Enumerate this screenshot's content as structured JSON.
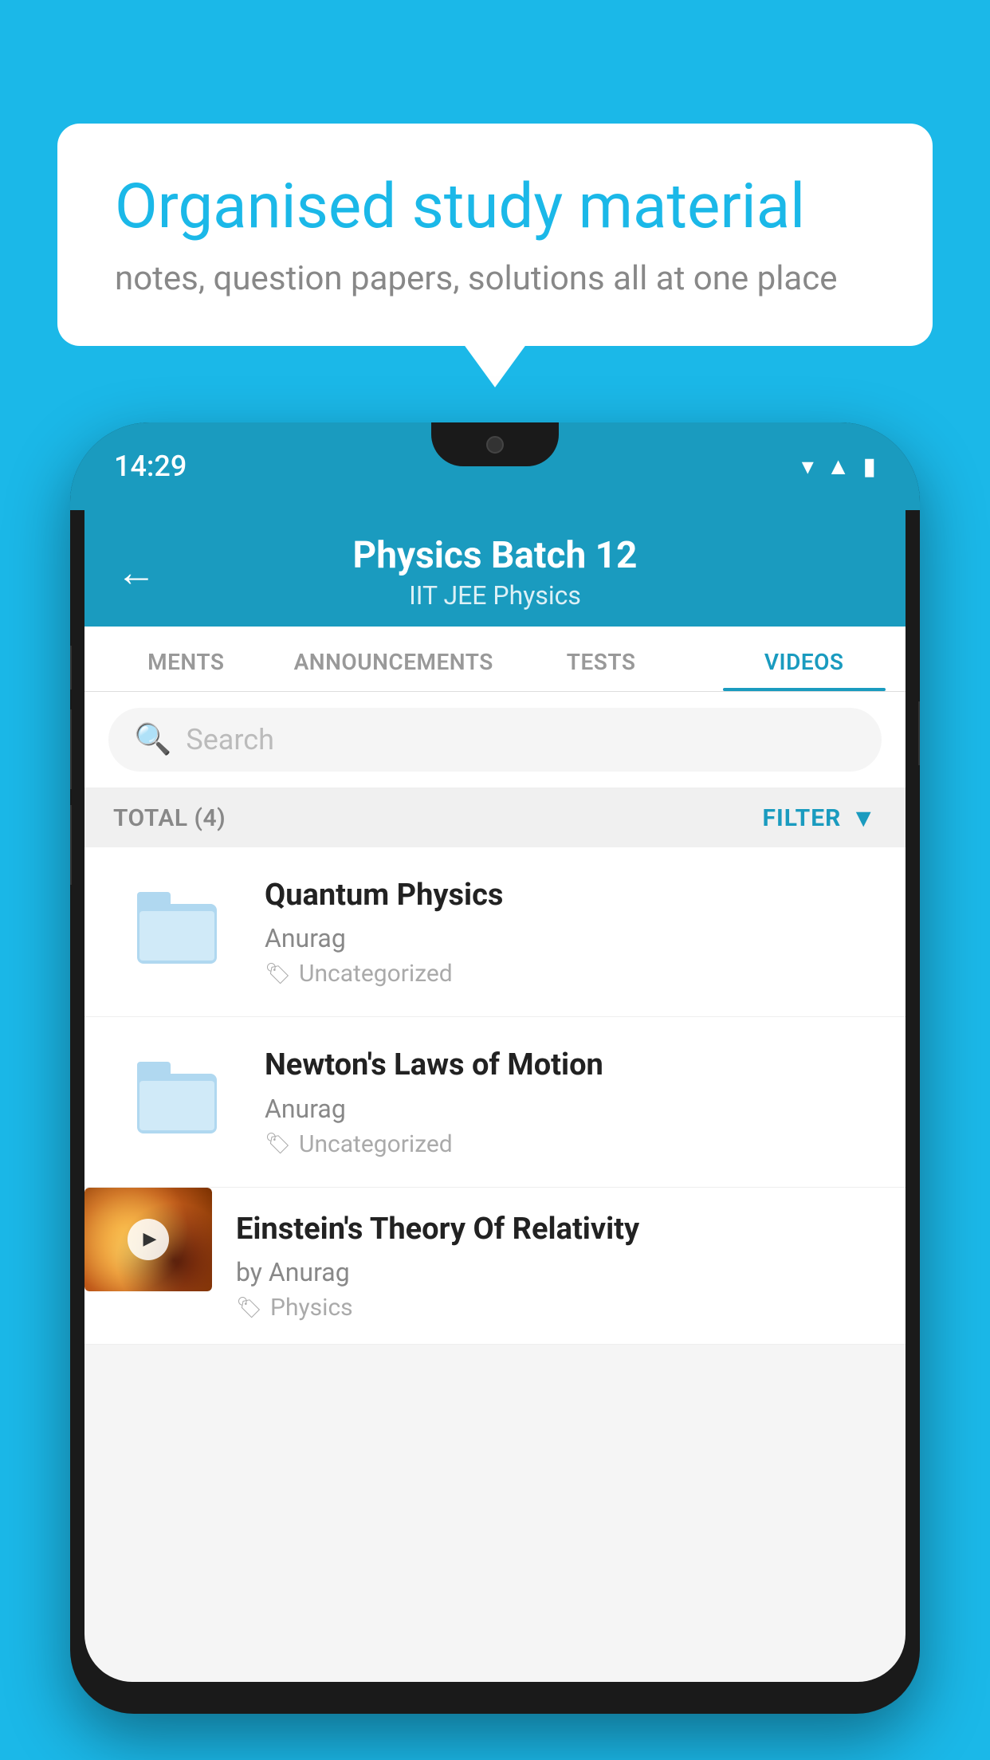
{
  "background_color": "#1BB8E8",
  "speech_bubble": {
    "title": "Organised study material",
    "subtitle": "notes, question papers, solutions all at one place"
  },
  "phone": {
    "status_time": "14:29",
    "toolbar": {
      "title": "Physics Batch 12",
      "subtitle_tags": "IIT JEE   Physics",
      "back_label": "←"
    },
    "tabs": [
      {
        "label": "MENTS",
        "active": false
      },
      {
        "label": "ANNOUNCEMENTS",
        "active": false
      },
      {
        "label": "TESTS",
        "active": false
      },
      {
        "label": "VIDEOS",
        "active": true
      }
    ],
    "search": {
      "placeholder": "Search"
    },
    "filter": {
      "total_label": "TOTAL (4)",
      "filter_label": "FILTER"
    },
    "videos": [
      {
        "id": 1,
        "title": "Quantum Physics",
        "author": "Anurag",
        "tag": "Uncategorized",
        "type": "folder"
      },
      {
        "id": 2,
        "title": "Newton's Laws of Motion",
        "author": "Anurag",
        "tag": "Uncategorized",
        "type": "folder"
      },
      {
        "id": 3,
        "title": "Einstein's Theory Of Relativity",
        "author": "by Anurag",
        "tag": "Physics",
        "type": "video"
      }
    ]
  }
}
